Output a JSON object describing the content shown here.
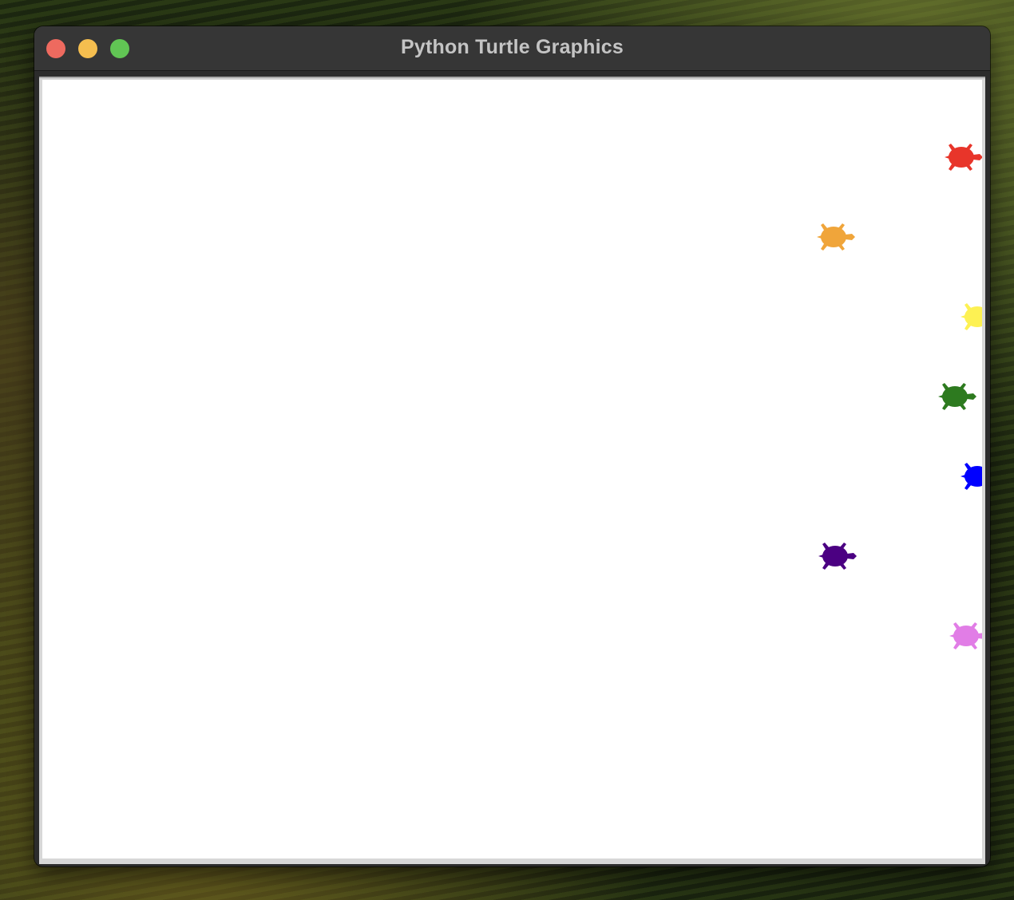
{
  "window": {
    "title": "Python Turtle Graphics"
  },
  "buttons": {
    "close": "close",
    "minimize": "minimize",
    "zoom": "zoom"
  },
  "turtles": [
    {
      "name": "turtle-red",
      "color": "#e8352a"
    },
    {
      "name": "turtle-orange",
      "color": "#f0a53a"
    },
    {
      "name": "turtle-yellow",
      "color": "#fdf153"
    },
    {
      "name": "turtle-green",
      "color": "#2d7a1f"
    },
    {
      "name": "turtle-blue",
      "color": "#0000ff"
    },
    {
      "name": "turtle-indigo",
      "color": "#4b0082"
    },
    {
      "name": "turtle-violet",
      "color": "#e17de6"
    }
  ],
  "icons": {
    "turtle": "turtle-icon"
  }
}
